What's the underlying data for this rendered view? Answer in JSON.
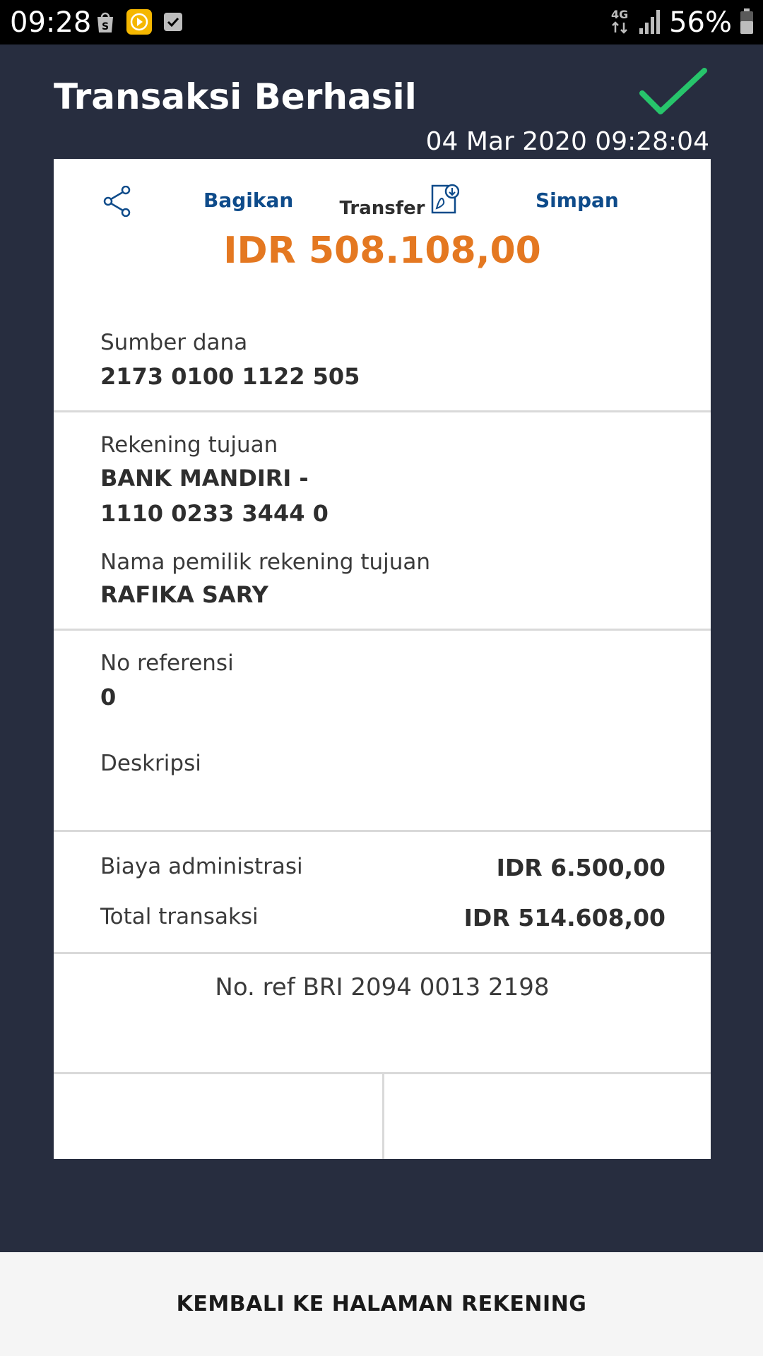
{
  "status_bar": {
    "time": "09:28",
    "network": "4G",
    "battery": "56%",
    "icons": [
      "shopping-bag-icon",
      "media-icon",
      "checkbox-icon",
      "signal-icon",
      "battery-icon"
    ]
  },
  "header": {
    "title": "Transaksi Berhasil",
    "datetime": "04 Mar 2020 09:28:04",
    "success_color": "#27c46b"
  },
  "transaction": {
    "type": "Transfer",
    "amount": "IDR 508.108,00",
    "amount_color": "#e47821"
  },
  "details": {
    "source_label": "Sumber dana",
    "source_value": "2173 0100 1122 505",
    "dest_label": "Rekening tujuan",
    "dest_value_line1": "BANK MANDIRI -",
    "dest_value_line2": "1110 0233 3444 0",
    "owner_label": "Nama pemilik rekening tujuan",
    "owner_value": "RAFIKA SARY",
    "ref_label": "No referensi",
    "ref_value": "0",
    "desc_label": "Deskripsi",
    "desc_value": ""
  },
  "summary": {
    "admin_label": "Biaya administrasi",
    "admin_value": "IDR 6.500,00",
    "total_label": "Total transaksi",
    "total_value": "IDR 514.608,00",
    "bri_ref": "No. ref BRI 2094 0013 2198"
  },
  "actions": {
    "share_label": "Bagikan",
    "save_label": "Simpan",
    "accent": "#0e4b8a"
  },
  "bottom": {
    "back_label": "KEMBALI KE HALAMAN REKENING"
  }
}
